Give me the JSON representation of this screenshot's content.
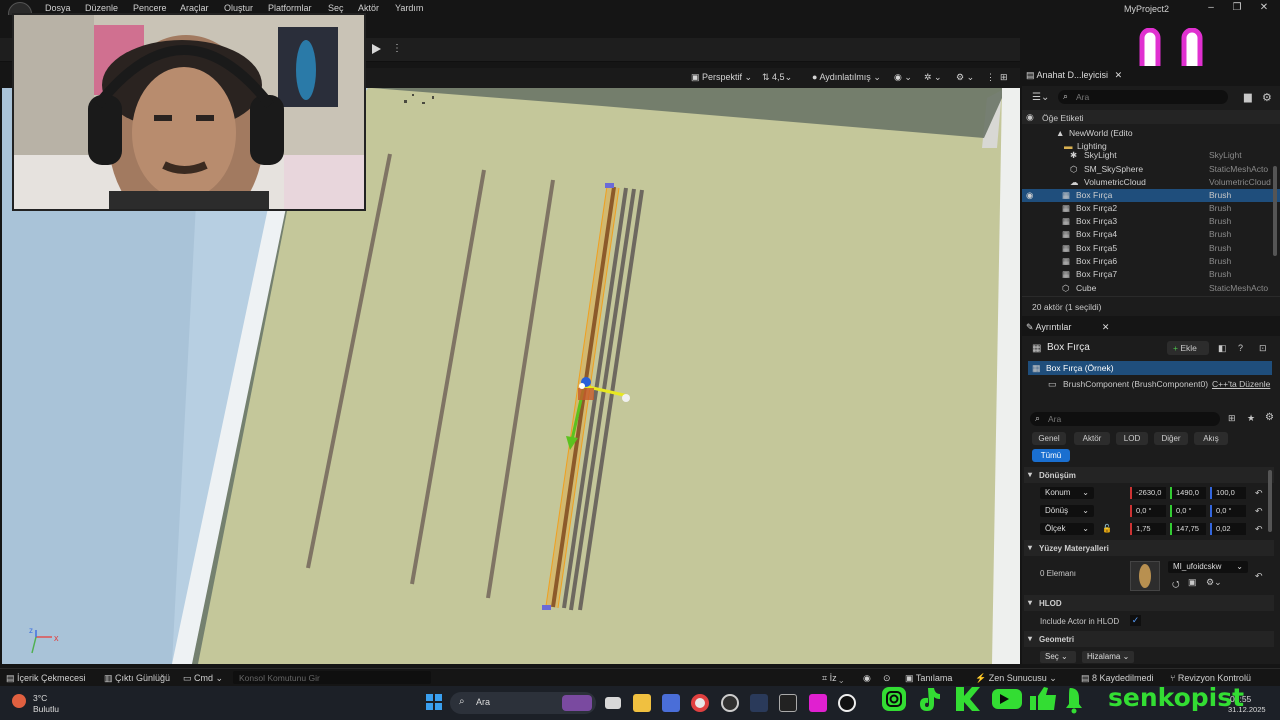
{
  "menu": {
    "items": [
      "Dosya",
      "Düzenle",
      "Pencere",
      "Araçlar",
      "Oluştur",
      "Platformlar",
      "Seç",
      "Aktör",
      "Yardım"
    ],
    "project_title": "MyProject2"
  },
  "viewport": {
    "perspective_label": "Perspektif",
    "camera_speed": "4,5",
    "lighting_label": "Aydınlatılmış",
    "axis_x": "x",
    "axis_z": "z"
  },
  "outliner": {
    "tab_title": "Anahat D...leyicisi",
    "search_placeholder": "Ara",
    "column_label": "Öğe Etiketi",
    "rows": [
      {
        "name": "NewWorld (Edito",
        "type": ""
      },
      {
        "name": "Lighting",
        "type": ""
      },
      {
        "name": "SkyLight",
        "type": "SkyLight"
      },
      {
        "name": "SM_SkySphere",
        "type": "StaticMeshActo"
      },
      {
        "name": "VolumetricCloud",
        "type": "VolumetricCloud"
      },
      {
        "name": "Box Fırça",
        "type": "Brush"
      },
      {
        "name": "Box Fırça2",
        "type": "Brush"
      },
      {
        "name": "Box Fırça3",
        "type": "Brush"
      },
      {
        "name": "Box Fırça4",
        "type": "Brush"
      },
      {
        "name": "Box Fırça5",
        "type": "Brush"
      },
      {
        "name": "Box Fırça6",
        "type": "Brush"
      },
      {
        "name": "Box Fırça7",
        "type": "Brush"
      },
      {
        "name": "Cube",
        "type": "StaticMeshActo"
      }
    ],
    "footer": "20 aktör (1 seçildi)"
  },
  "details": {
    "tab_title": "Ayrıntılar",
    "actor_name": "Box Fırça",
    "add_label": "Ekle",
    "instance_label": "Box Fırça (Örnek)",
    "component_label": "BrushComponent (BrushComponent0)",
    "cpp_link": "C++'ta Düzenle",
    "search_placeholder": "Ara",
    "filters": [
      "Genel",
      "Aktör",
      "LOD",
      "Diğer",
      "Akış"
    ],
    "filter_all": "Tümü",
    "transform_header": "Dönüşüm",
    "location_label": "Konum",
    "location": [
      "-2630,0",
      "1490,0",
      "100,0"
    ],
    "rotation_label": "Dönüş",
    "rotation": [
      "0,0 °",
      "0,0 °",
      "0,0 °"
    ],
    "scale_label": "Ölçek",
    "scale": [
      "1,75",
      "147,75",
      "0,02"
    ],
    "materials_header": "Yüzey Materyalleri",
    "elements_label": "0 Elemanı",
    "material_name": "MI_ufoidcskw",
    "hlod_header": "HLOD",
    "include_hlod_label": "Include Actor in HLOD",
    "geometry_header": "Geometri",
    "select_label": "Seç",
    "align_label": "Hizalama"
  },
  "bottombar": {
    "content_browser": "İçerik Çekmecesi",
    "output_log": "Çıktı Günlüğü",
    "cmd": "Cmd",
    "console_placeholder": "Konsol Komutunu Gir",
    "trace": "İz",
    "describe": "Tanılama",
    "zen": "Zen Sunucusu",
    "saved": "8 Kaydedilmedi",
    "revision": "Revizyon Kontrolü"
  },
  "taskbar": {
    "weather_temp": "3°C",
    "weather_desc": "Bulutlu",
    "search_label": "Ara",
    "time": "08:55",
    "date": "31.12.2025"
  },
  "overlay": {
    "brand": "senkopist"
  },
  "colors": {
    "accent_blue": "#1f4e7c",
    "selection_orange": "#f0a020",
    "floor": "#c4c79a",
    "brand_green": "#33dd33",
    "smile_pink": "#e030d0"
  }
}
